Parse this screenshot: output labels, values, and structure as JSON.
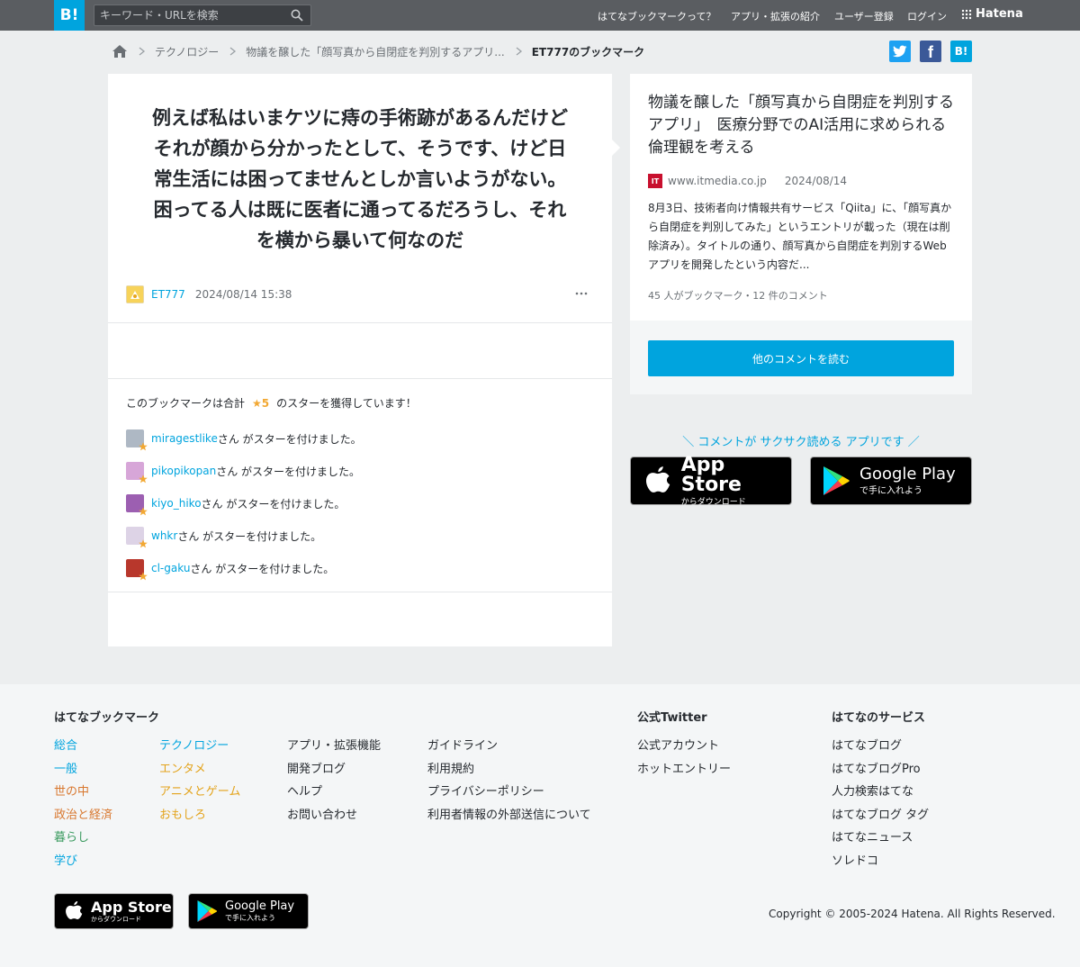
{
  "header": {
    "logo": "B!",
    "search_placeholder": "キーワード・URLを検索",
    "nav": [
      "はてなブックマークって？",
      "アプリ・拡張の紹介",
      "ユーザー登録",
      "ログイン"
    ],
    "brand": "Hatena"
  },
  "breadcrumb": {
    "items": [
      "テクノロジー",
      "物議を醸した「顔写真から自閉症を判別するアプリ..."
    ],
    "current": "ET777のブックマーク"
  },
  "share": {
    "twitter": "twitter-icon",
    "facebook": "f",
    "hatena": "B!"
  },
  "bookmark": {
    "comment_lines": [
      "例えば私はいまケツに痔の手術跡があるんだけど",
      "それが顔から分かったとして、そうです、けど日",
      "常生活には困ってませんとしか言いようがない。",
      "困ってる人は既に医者に通ってるだろうし、それ",
      "を横から暴いて何なのだ"
    ],
    "user": "ET777",
    "timestamp": "2024/08/14 15:38"
  },
  "stars": {
    "intro_prefix": "このブックマークは合計",
    "count": "★5",
    "intro_suffix": "のスターを獲得しています！",
    "suffix_text": "さん がスターを付けました。",
    "users": [
      {
        "name": "miragestlike",
        "color": "#aeb8c4"
      },
      {
        "name": "pikopikopan",
        "color": "#d7a6d8"
      },
      {
        "name": "kiyo_hiko",
        "color": "#9c5fb1"
      },
      {
        "name": "whkr",
        "color": "#ddd3e6"
      },
      {
        "name": "cl-gaku",
        "color": "#b8372c"
      }
    ]
  },
  "entry": {
    "title": "物議を醸した「顔写真から自閉症を判別するアプリ」　医療分野でのAI活用に求められる倫理観を考える",
    "favicon": "IT",
    "domain": "www.itmedia.co.jp",
    "date": "2024/08/14",
    "summary": "8月3日、技術者向け情報共有サービス「Qiita」に、「顔写真から自閉症を判別してみた」というエントリが載った（現在は削除済み）。タイトルの通り、顔写真から自閉症を判別するWebアプリを開発したという内容だ...",
    "count_text": "45 人がブックマーク・12 件のコメント",
    "read_button": "他のコメントを読む"
  },
  "promo": {
    "text": "＼ コメントが サクサク読める アプリです ／",
    "app_store_title": "App Store",
    "app_store_sub": "からダウンロード",
    "google_play_title": "Google Play",
    "google_play_sub": "で手に入れよう"
  },
  "footer": {
    "bookmark_head": "はてなブックマーク",
    "categories_col1": [
      {
        "label": "総合",
        "color": "#00a4de"
      },
      {
        "label": "一般",
        "color": "#00a4de"
      },
      {
        "label": "世の中",
        "color": "#d8772e"
      },
      {
        "label": "政治と経済",
        "color": "#d8772e"
      },
      {
        "label": "暮らし",
        "color": "#3a9a5f"
      },
      {
        "label": "学び",
        "color": "#00a4de"
      }
    ],
    "categories_col2": [
      {
        "label": "テクノロジー",
        "color": "#00a4de"
      },
      {
        "label": "エンタメ",
        "color": "#e3a31b"
      },
      {
        "label": "アニメとゲーム",
        "color": "#e3a31b"
      },
      {
        "label": "おもしろ",
        "color": "#e3a31b"
      }
    ],
    "col3": [
      "アプリ・拡張機能",
      "開発ブログ",
      "ヘルプ",
      "お問い合わせ"
    ],
    "col4": [
      "ガイドライン",
      "利用規約",
      "プライバシーポリシー",
      "利用者情報の外部送信について"
    ],
    "twitter_head": "公式Twitter",
    "twitter_links": [
      "公式アカウント",
      "ホットエントリー"
    ],
    "services_head": "はてなのサービス",
    "services": [
      "はてなブログ",
      "はてなブログPro",
      "人力検索はてな",
      "はてなブログ タグ",
      "はてなニュース",
      "ソレドコ"
    ],
    "copyright": "Copyright © 2005-2024 Hatena. All Rights Reserved."
  }
}
